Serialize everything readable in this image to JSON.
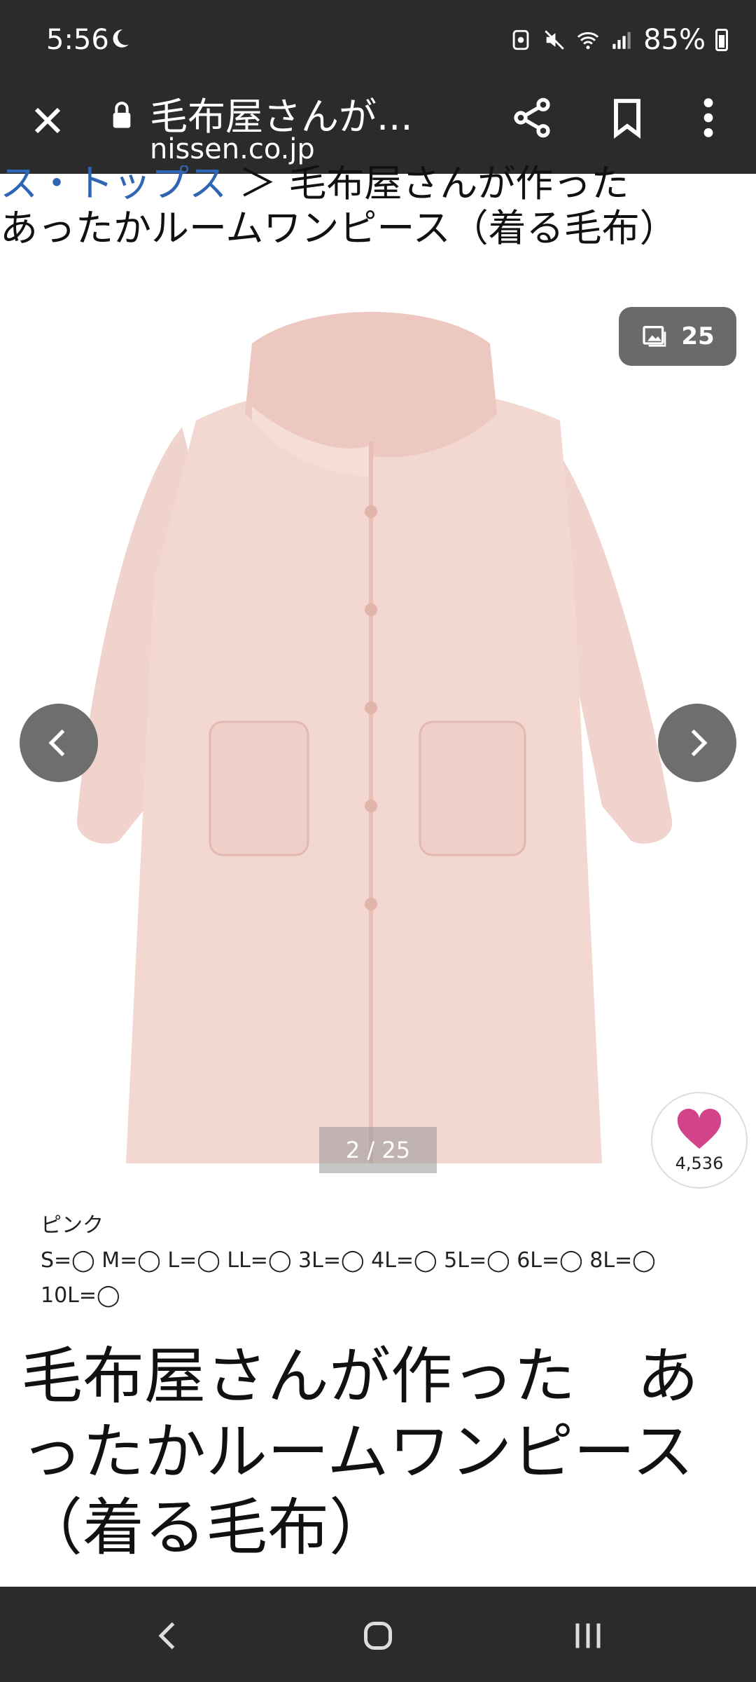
{
  "status_bar": {
    "time": "5:56",
    "battery": "85%"
  },
  "browser": {
    "page_title": "毛布屋さんが...",
    "domain": "nissen.co.jp"
  },
  "breadcrumb": {
    "link_text": "ス・トップス",
    "separator": "＞",
    "current_line1": "毛布屋さんが作った",
    "current_line2": "あったかルームワンピース（着る毛布）"
  },
  "gallery": {
    "image_count": "25",
    "page_indicator": "2 / 25",
    "favorite_count": "4,536"
  },
  "variant": {
    "color": "ピンク",
    "sizes_line1": "S=◯ M=◯ L=◯ LL=◯ 3L=◯ 4L=◯ 5L=◯ 6L=◯ 8L=◯",
    "sizes_line2": "10L=◯"
  },
  "product": {
    "title_line1": "毛布屋さんが作った　あ",
    "title_line2": "ったかルームワンピース",
    "title_line3": "（着る毛布）"
  },
  "colors": {
    "header_bg": "#2b2b2b",
    "link": "#2f66b3",
    "heart": "#d1448a",
    "garment": "#f1d3cd"
  },
  "icons": [
    "moon-icon",
    "mute-icon",
    "wifi-icon",
    "signal-icon",
    "battery-icon",
    "close-icon",
    "lock-icon",
    "share-icon",
    "bookmark-icon",
    "more-vert-icon",
    "gallery-icon",
    "chevron-left-icon",
    "chevron-right-icon",
    "heart-icon",
    "nav-back-icon",
    "nav-home-icon",
    "nav-recents-icon"
  ]
}
